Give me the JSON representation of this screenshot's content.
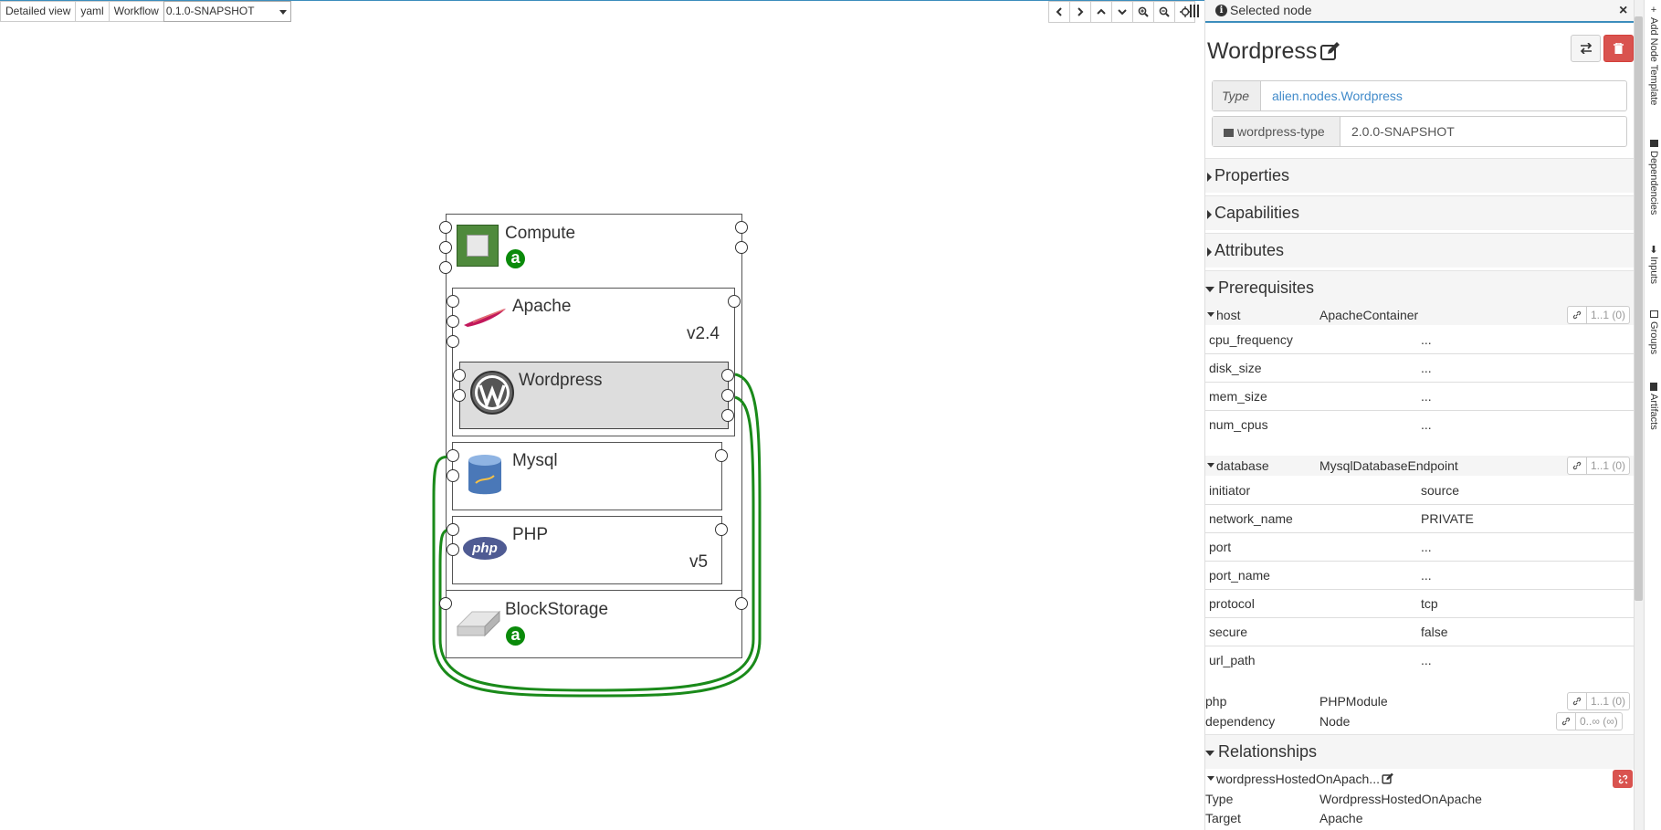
{
  "toolbar": {
    "detailed_view": "Detailed view",
    "yaml": "yaml",
    "workflow": "Workflow",
    "version_selected": "0.1.0-SNAPSHOT"
  },
  "zoom_toolbar": {
    "icons": [
      "chevron-left-icon",
      "chevron-right-icon",
      "chevron-up-icon",
      "chevron-down-icon",
      "zoom-in-icon",
      "zoom-out-icon",
      "crosshair-icon"
    ]
  },
  "topology": {
    "nodes": {
      "compute": {
        "name": "Compute",
        "badge": "a",
        "icon": "processor-chip-icon"
      },
      "apache": {
        "name": "Apache",
        "version": "v2.4",
        "icon": "apache-feather-icon"
      },
      "wordpress": {
        "name": "Wordpress",
        "icon": "wordpress-logo-icon",
        "selected": true
      },
      "mysql": {
        "name": "Mysql",
        "icon": "database-icon"
      },
      "php": {
        "name": "PHP",
        "version": "v5",
        "icon": "php-logo-icon",
        "logo_text": "php"
      },
      "blockstorage": {
        "name": "BlockStorage",
        "badge": "a",
        "icon": "hard-drive-icon"
      }
    },
    "relationship_color": "#1a8a1a"
  },
  "panel": {
    "header": "Selected node",
    "node_name": "Wordpress",
    "type_label": "Type",
    "type_value": "alien.nodes.Wordpress",
    "archive_label": "wordpress-type",
    "archive_value": "2.0.0-SNAPSHOT",
    "sections": {
      "properties": "Properties",
      "capabilities": "Capabilities",
      "attributes": "Attributes",
      "prerequisites": "Prerequisites",
      "relationships": "Relationships"
    },
    "requirements": {
      "host": {
        "name": "host",
        "type": "ApacheContainer",
        "bounds": "1..1 (0)",
        "props": [
          {
            "k": "cpu_frequency",
            "v": "..."
          },
          {
            "k": "disk_size",
            "v": "..."
          },
          {
            "k": "mem_size",
            "v": "..."
          },
          {
            "k": "num_cpus",
            "v": "..."
          }
        ]
      },
      "database": {
        "name": "database",
        "type": "MysqlDatabaseEndpoint",
        "bounds": "1..1 (0)",
        "props": [
          {
            "k": "initiator",
            "v": "source"
          },
          {
            "k": "network_name",
            "v": "PRIVATE"
          },
          {
            "k": "port",
            "v": "..."
          },
          {
            "k": "port_name",
            "v": "..."
          },
          {
            "k": "protocol",
            "v": "tcp"
          },
          {
            "k": "secure",
            "v": "false"
          },
          {
            "k": "url_path",
            "v": "..."
          }
        ]
      },
      "php": {
        "name": "php",
        "type": "PHPModule",
        "bounds": "1..1 (0)"
      },
      "dependency": {
        "name": "dependency",
        "type": "Node",
        "bounds": "0..∞ (∞)"
      }
    },
    "relationship": {
      "name": "wordpressHostedOnApach...",
      "type_label": "Type",
      "type_value": "WordpressHostedOnApache",
      "target_label": "Target",
      "target_value": "Apache"
    },
    "colors": {
      "link": "#428bca",
      "danger": "#d9534f",
      "accent": "#3c8dbc"
    }
  },
  "side_tabs": [
    {
      "label": "Add Node Template",
      "icon": "plus-icon"
    },
    {
      "label": "Dependencies",
      "icon": "archive-icon"
    },
    {
      "label": "Inputs",
      "icon": "download-icon"
    },
    {
      "label": "Groups",
      "icon": "folder-icon"
    },
    {
      "label": "Artifacts",
      "icon": "file-icon"
    }
  ]
}
